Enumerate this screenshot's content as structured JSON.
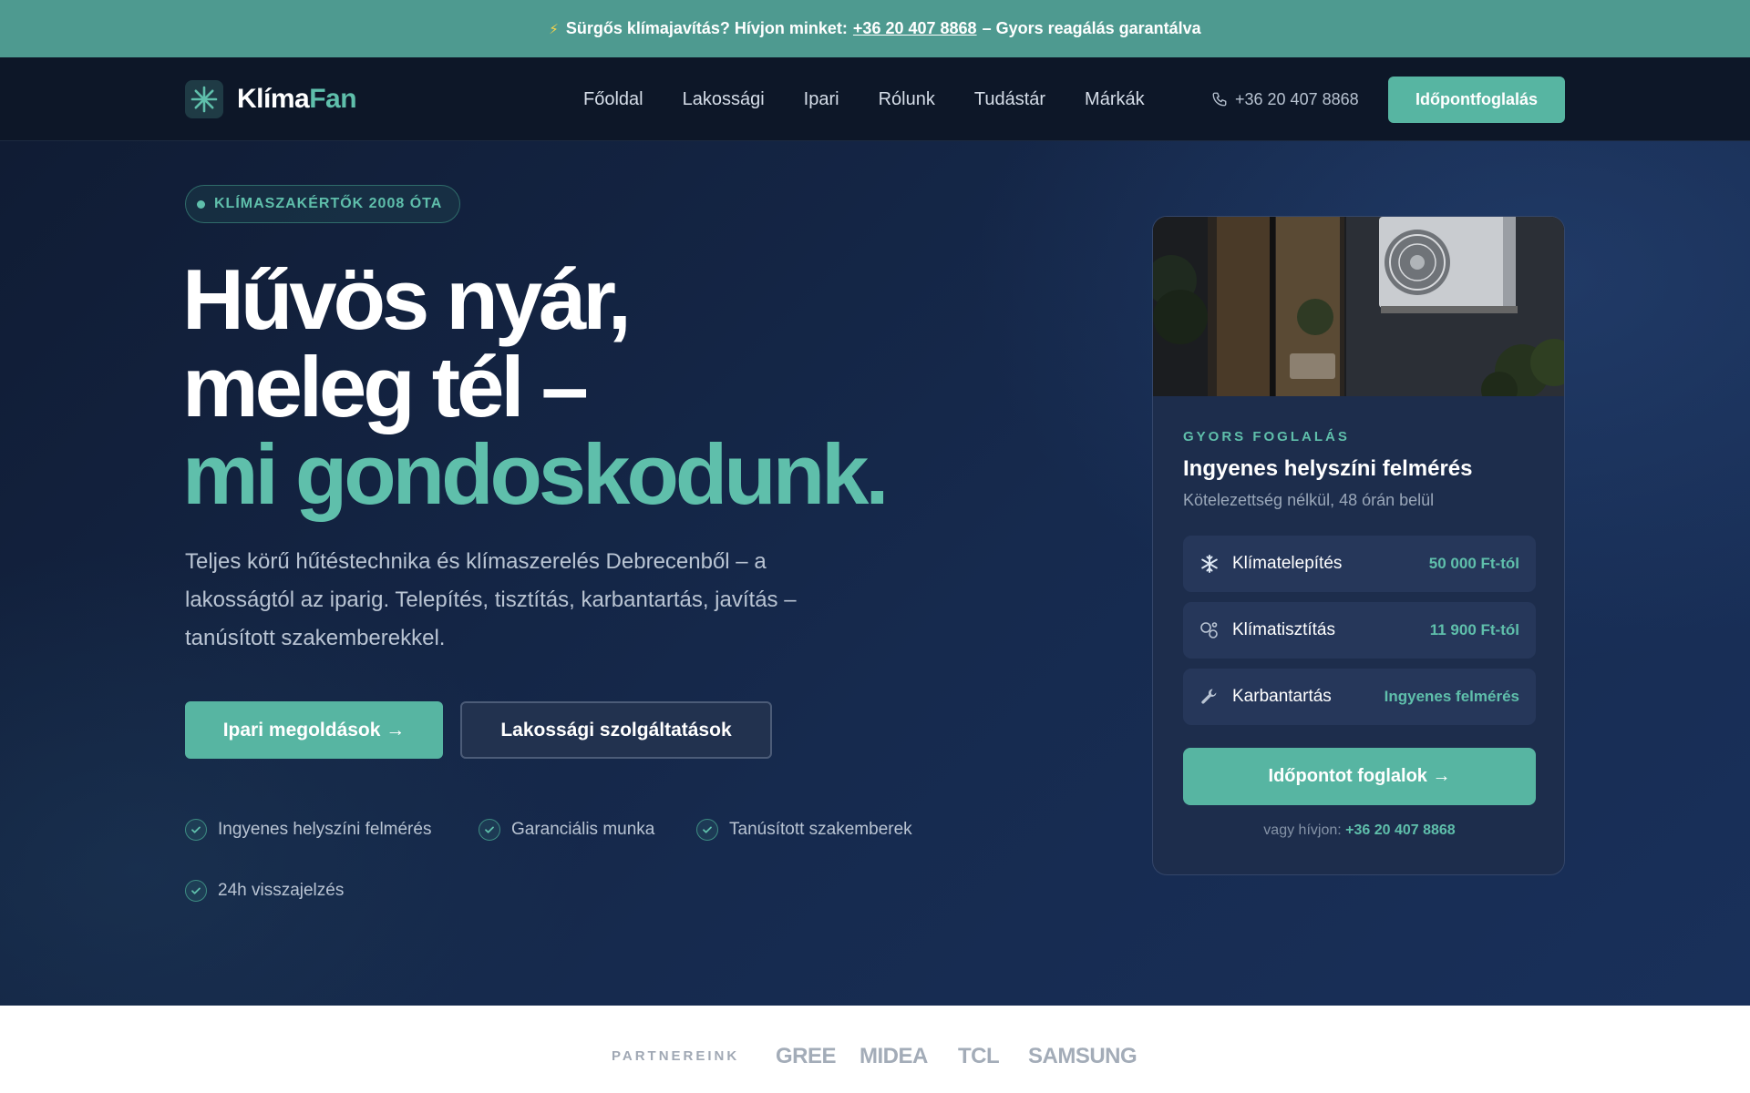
{
  "alert": {
    "prefix": "Sürgős klímajavítás? Hívjon minket:",
    "phone": "+36 20 407 8868",
    "suffix": "– Gyors reagálás garantálva"
  },
  "brand": {
    "name_part1": "Klíma",
    "name_part2": "Fan"
  },
  "nav": {
    "links": [
      "Főoldal",
      "Lakossági",
      "Ipari",
      "Rólunk",
      "Tudástár",
      "Márkák"
    ],
    "phone": "+36 20 407 8868",
    "cta": "Időpontfoglalás"
  },
  "hero": {
    "badge": "KLÍMASZAKÉRTŐK 2008 ÓTA",
    "headline": [
      "Hűvös nyár,",
      "meleg tél –",
      "mi gondoskodunk."
    ],
    "lead": "Teljes körű hűtéstechnika és klímaszerelés Debrecenből – a lakosságtól az iparig. Telepítés, tisztítás, karbantartás, javítás – tanúsított szakemberekkel.",
    "primary_button": "Ipari megoldások →",
    "secondary_button": "Lakossági szolgáltatások",
    "features": [
      "Ingyenes helyszíni felmérés",
      "Garanciális munka",
      "Tanúsított szakemberek",
      "24h visszajelzés"
    ]
  },
  "booking": {
    "eyebrow": "GYORS FOGLALÁS",
    "title": "Ingyenes helyszíni felmérés",
    "subtitle": "Kötelezettség nélkül, 48 órán belül",
    "services": [
      {
        "icon": "snowflake-icon",
        "name": "Klímatelepítés",
        "price": "50 000 Ft-tól"
      },
      {
        "icon": "bubbles-icon",
        "name": "Klímatisztítás",
        "price": "11 900 Ft-tól"
      },
      {
        "icon": "wrench-icon",
        "name": "Karbantartás",
        "price": "Ingyenes felmérés"
      }
    ],
    "cta": "Időpontot foglalok →",
    "footer_prefix": "vagy hívjon:",
    "footer_phone": "+36 20 407 8868"
  },
  "partners": {
    "label": "PARTNEREINK",
    "brands": [
      "GREE",
      "MIDEA",
      "TCL",
      "SAMSUNG"
    ]
  },
  "colors": {
    "accent": "#57b5a2",
    "alert_bg": "#4e9a90",
    "nav_bg": "#0d1728",
    "hero_bg": "#162a4e",
    "card_bg": "#1d2d4c"
  }
}
